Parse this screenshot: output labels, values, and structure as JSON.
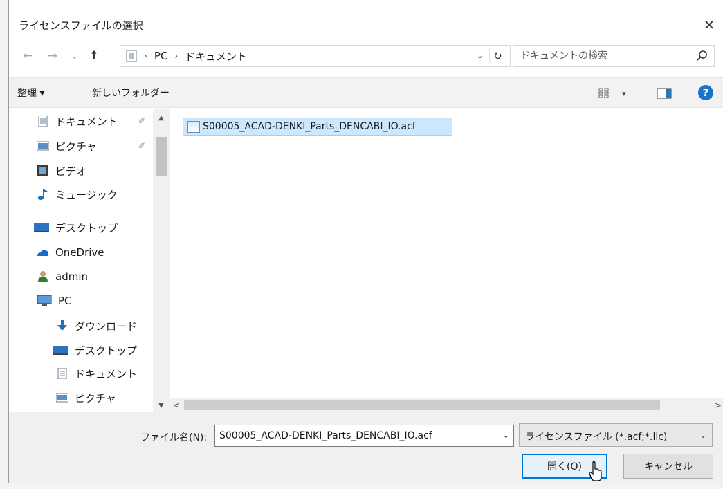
{
  "window": {
    "title": "ライセンスファイルの選択",
    "close_label": "✕"
  },
  "address": {
    "back_icon": "←",
    "forward_icon": "→",
    "recent_icon": "⌄",
    "up_icon": "↑",
    "crumbs": [
      "PC",
      "ドキュメント"
    ],
    "separator": "›",
    "dropdown_icon": "⌄",
    "refresh_icon": "↻"
  },
  "search": {
    "placeholder": "ドキュメントの検索"
  },
  "toolbar": {
    "organize_label": "整理 ▾",
    "new_folder_label": "新しいフォルダー",
    "view_caret": "▾",
    "help_label": "?"
  },
  "sidebar": {
    "items": [
      {
        "label": "ドキュメント",
        "icon": "documents-icon",
        "pinned": true
      },
      {
        "label": "ピクチャ",
        "icon": "pictures-icon",
        "pinned": true
      },
      {
        "label": "ビデオ",
        "icon": "videos-icon",
        "pinned": false
      },
      {
        "label": "ミュージック",
        "icon": "music-icon",
        "pinned": false
      },
      {
        "label": "デスクトップ",
        "icon": "desktop-icon",
        "pinned": false
      },
      {
        "label": "OneDrive",
        "icon": "onedrive-icon",
        "pinned": false
      },
      {
        "label": "admin",
        "icon": "user-icon",
        "pinned": false
      },
      {
        "label": "PC",
        "icon": "pc-icon",
        "pinned": false
      },
      {
        "label": "ダウンロード",
        "icon": "downloads-icon",
        "pinned": false
      },
      {
        "label": "デスクトップ",
        "icon": "desktop-icon",
        "pinned": false
      },
      {
        "label": "ドキュメント",
        "icon": "documents-icon",
        "pinned": false
      },
      {
        "label": "ピクチャ",
        "icon": "pictures-icon",
        "pinned": false
      }
    ],
    "pin_glyph": "✐",
    "scroll_up": "▲",
    "scroll_down": "▼"
  },
  "files": [
    {
      "name": "S00005_ACAD-DENKI_Parts_DENCABI_IO.acf",
      "selected": true
    }
  ],
  "hscroll": {
    "left": "<",
    "right": ">"
  },
  "bottom": {
    "filename_label": "ファイル名(N):",
    "filename_value": "S00005_ACAD-DENKI_Parts_DENCABI_IO.acf",
    "filename_dropdown": "⌄",
    "filter_value": "ライセンスファイル (*.acf;*.lic)",
    "filter_dropdown": "⌄",
    "open_label": "開く(O)",
    "cancel_label": "キャンセル"
  },
  "colors": {
    "accent": "#0078d7",
    "selection": "#cce8ff",
    "help": "#1a73c8"
  }
}
